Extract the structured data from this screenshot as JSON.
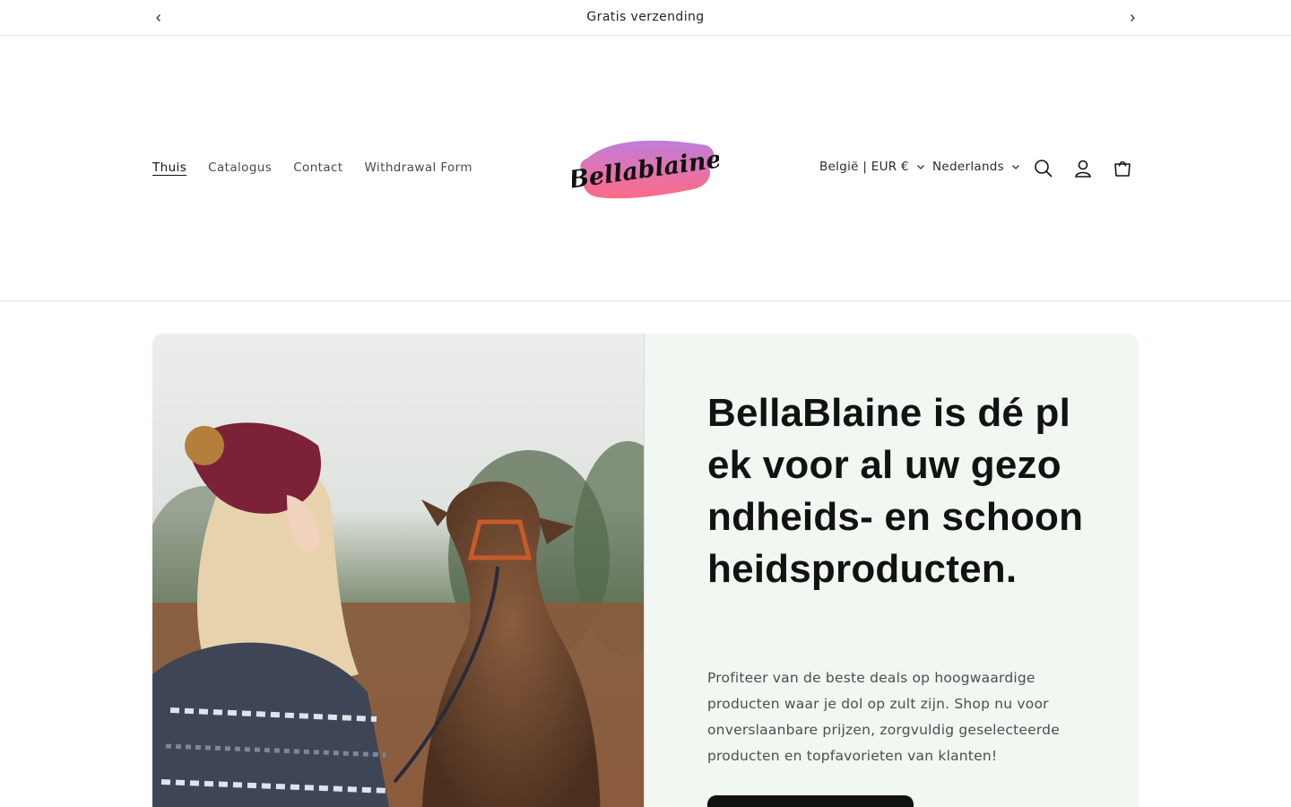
{
  "announcement": {
    "message": "Gratis verzending"
  },
  "header": {
    "nav": [
      {
        "label": "Thuis",
        "active": true
      },
      {
        "label": "Catalogus",
        "active": false
      },
      {
        "label": "Contact",
        "active": false
      },
      {
        "label": "Withdrawal Form",
        "active": false
      }
    ],
    "logo_text": "Bellablaine",
    "country_selector": "België | EUR €",
    "language_selector": "Nederlands",
    "icons": [
      "search-icon",
      "account-icon",
      "cart-icon"
    ]
  },
  "hero": {
    "heading": "BellaBlaine is dé plek voor al uw gezondheids- en schoonheidsproducten.",
    "description": "Profiteer van de beste deals op hoogwaardige producten waar je dol op zult zijn. Shop nu voor onverslaanbare prijzen, zorgvuldig geselecteerde producten en topfavorieten van klanten!",
    "button_label": "",
    "image": "woman-with-llama"
  },
  "colors": {
    "hero_text_bg": "#f1f8f1",
    "logo_gradient_start": "#b86fd6",
    "logo_gradient_end": "#ff5a76",
    "text_primary": "#121212"
  }
}
